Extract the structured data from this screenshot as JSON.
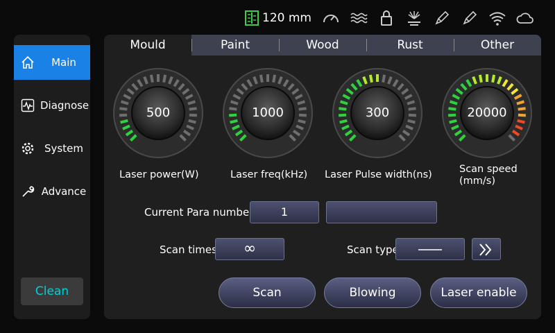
{
  "status": {
    "distance": "120 mm",
    "icons": [
      "ruler-icon",
      "speedometer-icon",
      "waves-icon",
      "lock-icon",
      "laser-icon",
      "pen-icon",
      "pen-icon",
      "wifi-icon",
      "cloud-icon"
    ]
  },
  "sidebar": {
    "items": [
      {
        "label": "Main",
        "icon": "home-icon",
        "active": true
      },
      {
        "label": "Diagnose",
        "icon": "pulse-icon"
      },
      {
        "label": "System",
        "icon": "gear-icon"
      },
      {
        "label": "Advance",
        "icon": "wrench-icon"
      }
    ],
    "clean_label": "Clean"
  },
  "tabs": [
    "Mould",
    "Paint",
    "Wood",
    "Rust",
    "Other"
  ],
  "active_tab": "Mould",
  "gauges": [
    {
      "value": "500",
      "label": "Laser power(W)",
      "level": 4
    },
    {
      "value": "1000",
      "label": "Laser freq(kHz)",
      "level": 5
    },
    {
      "value": "300",
      "label": "Laser Pulse width(ns)",
      "level": 14
    },
    {
      "value": "20000",
      "label": "Scan speed (mm/s)",
      "label_line1": "Scan speed",
      "label_line2": "(mm/s)",
      "level": 26
    }
  ],
  "gauge_ticks": 27,
  "colors": {
    "tick_off": "#6e6e6e",
    "accent": "#1a82e6",
    "clean": "#00d2d8"
  },
  "params": {
    "current_para_label": "Current Para number",
    "current_para_value": "1",
    "current_para_name": "",
    "scan_times_label": "Scan times",
    "scan_times_value": "∞",
    "scan_type_label": "Scan type"
  },
  "buttons": {
    "scan": "Scan",
    "blowing": "Blowing",
    "laser_enable": "Laser enable"
  }
}
